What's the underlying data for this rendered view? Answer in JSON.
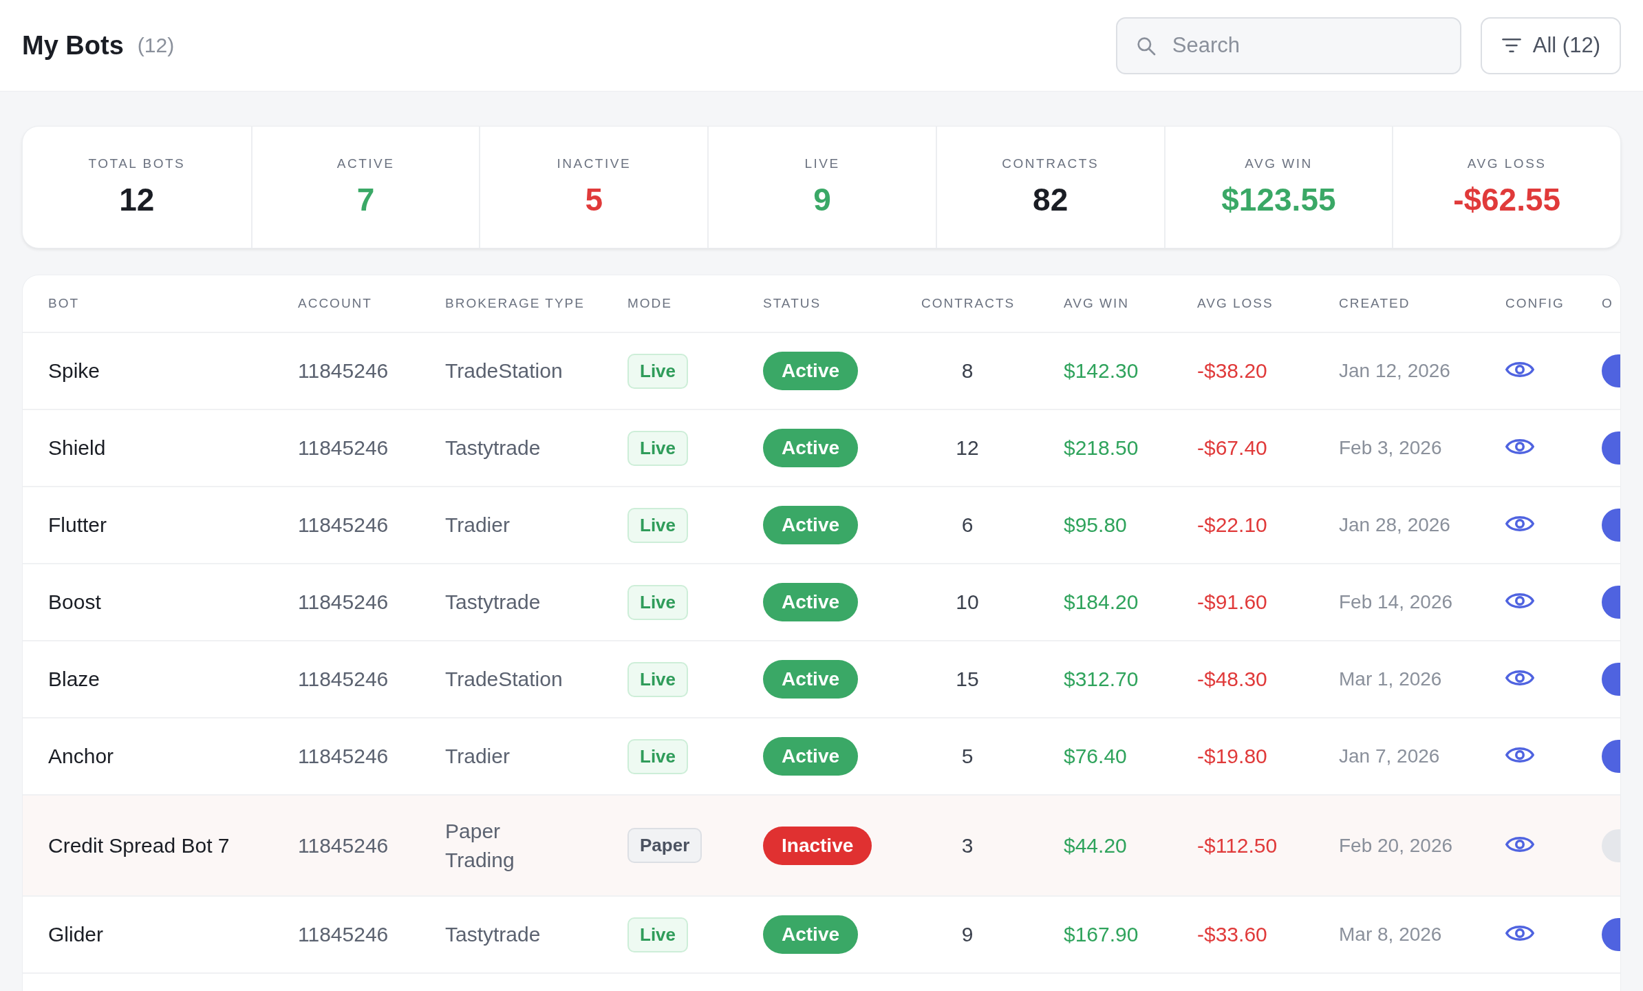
{
  "header": {
    "title": "My Bots",
    "count": "(12)",
    "search": {
      "placeholder": "Search"
    },
    "filter": {
      "label": "All (12)"
    }
  },
  "stats": [
    {
      "label": "TOTAL BOTS",
      "value": "12",
      "color": "#1a1d24"
    },
    {
      "label": "ACTIVE",
      "value": "7",
      "color": "#3aa866"
    },
    {
      "label": "INACTIVE",
      "value": "5",
      "color": "#e03a3a"
    },
    {
      "label": "LIVE",
      "value": "9",
      "color": "#3aa866"
    },
    {
      "label": "CONTRACTS",
      "value": "82",
      "color": "#1a1d24"
    },
    {
      "label": "AVG WIN",
      "value": "$123.55",
      "color": "#3aa866"
    },
    {
      "label": "AVG LOSS",
      "value": "-$62.55",
      "color": "#e03a3a"
    }
  ],
  "table": {
    "columns": [
      "BOT",
      "ACCOUNT",
      "BROKERAGE TYPE",
      "MODE",
      "STATUS",
      "CONTRACTS",
      "AVG WIN",
      "AVG LOSS",
      "CREATED",
      "CONFIG",
      "O"
    ],
    "rows": [
      {
        "bot": "Spike",
        "account": "11845246",
        "brokerage": "TradeStation",
        "mode": {
          "label": "Live",
          "kind": "live"
        },
        "status": {
          "label": "Active",
          "kind": "active"
        },
        "contracts": "8",
        "avg_win": "$142.30",
        "avg_loss": "-$38.20",
        "created": "Jan 12, 2026",
        "on": true
      },
      {
        "bot": "Shield",
        "account": "11845246",
        "brokerage": "Tastytrade",
        "mode": {
          "label": "Live",
          "kind": "live"
        },
        "status": {
          "label": "Active",
          "kind": "active"
        },
        "contracts": "12",
        "avg_win": "$218.50",
        "avg_loss": "-$67.40",
        "created": "Feb 3, 2026",
        "on": true
      },
      {
        "bot": "Flutter",
        "account": "11845246",
        "brokerage": "Tradier",
        "mode": {
          "label": "Live",
          "kind": "live"
        },
        "status": {
          "label": "Active",
          "kind": "active"
        },
        "contracts": "6",
        "avg_win": "$95.80",
        "avg_loss": "-$22.10",
        "created": "Jan 28, 2026",
        "on": true
      },
      {
        "bot": "Boost",
        "account": "11845246",
        "brokerage": "Tastytrade",
        "mode": {
          "label": "Live",
          "kind": "live"
        },
        "status": {
          "label": "Active",
          "kind": "active"
        },
        "contracts": "10",
        "avg_win": "$184.20",
        "avg_loss": "-$91.60",
        "created": "Feb 14, 2026",
        "on": true
      },
      {
        "bot": "Blaze",
        "account": "11845246",
        "brokerage": "TradeStation",
        "mode": {
          "label": "Live",
          "kind": "live"
        },
        "status": {
          "label": "Active",
          "kind": "active"
        },
        "contracts": "15",
        "avg_win": "$312.70",
        "avg_loss": "-$48.30",
        "created": "Mar 1, 2026",
        "on": true
      },
      {
        "bot": "Anchor",
        "account": "11845246",
        "brokerage": "Tradier",
        "mode": {
          "label": "Live",
          "kind": "live"
        },
        "status": {
          "label": "Active",
          "kind": "active"
        },
        "contracts": "5",
        "avg_win": "$76.40",
        "avg_loss": "-$19.80",
        "created": "Jan 7, 2026",
        "on": true
      },
      {
        "bot": "Credit Spread Bot 7",
        "account": "11845246",
        "brokerage": "Paper Trading",
        "mode": {
          "label": "Paper",
          "kind": "paper"
        },
        "status": {
          "label": "Inactive",
          "kind": "inactive"
        },
        "contracts": "3",
        "avg_win": "$44.20",
        "avg_loss": "-$112.50",
        "created": "Feb 20, 2026",
        "on": false
      },
      {
        "bot": "Glider",
        "account": "11845246",
        "brokerage": "Tastytrade",
        "mode": {
          "label": "Live",
          "kind": "live"
        },
        "status": {
          "label": "Active",
          "kind": "active"
        },
        "contracts": "9",
        "avg_win": "$167.90",
        "avg_loss": "-$33.60",
        "created": "Mar 8, 2026",
        "on": true
      }
    ]
  }
}
